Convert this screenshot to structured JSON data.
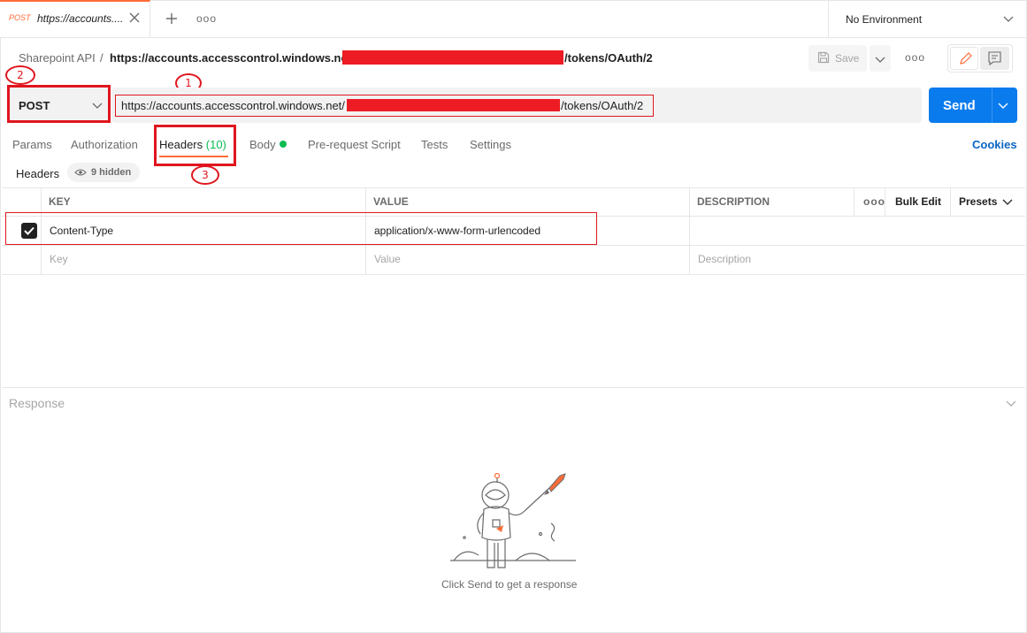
{
  "tab": {
    "method": "POST",
    "title": "https://accounts...."
  },
  "environment": {
    "label": "No Environment"
  },
  "breadcrumb": {
    "parent": "Sharepoint API",
    "separator": "/",
    "url_start": "https://accounts.accesscontrol.windows.net/",
    "url_end": "/tokens/OAuth/2"
  },
  "toolbar": {
    "save_label": "Save"
  },
  "request": {
    "method": "POST",
    "url_start": "https://accounts.accesscontrol.windows.net/",
    "url_end": "/tokens/OAuth/2",
    "send_label": "Send"
  },
  "request_tabs": {
    "params": "Params",
    "authorization": "Authorization",
    "headers": "Headers",
    "headers_count": "(10)",
    "body": "Body",
    "pre_request": "Pre-request Script",
    "tests": "Tests",
    "settings": "Settings",
    "cookies": "Cookies"
  },
  "headers_section": {
    "title": "Headers",
    "hidden": "9 hidden"
  },
  "table": {
    "columns": {
      "key": "KEY",
      "value": "VALUE",
      "description": "DESCRIPTION",
      "bulk_edit": "Bulk Edit",
      "presets": "Presets"
    },
    "rows": [
      {
        "key": "Content-Type",
        "value": "application/x-www-form-urlencoded",
        "checked": true
      }
    ],
    "placeholders": {
      "key": "Key",
      "value": "Value",
      "description": "Description"
    }
  },
  "annotations": {
    "marker1": "1",
    "marker2": "2",
    "marker3": "3"
  },
  "response": {
    "label": "Response",
    "hint": "Click Send to get a response"
  },
  "colors": {
    "accent": "#ff6c37",
    "send": "#097bed",
    "annotation": "#e0161e",
    "redaction": "#ed1c24",
    "active_count": "#0cbb52"
  }
}
